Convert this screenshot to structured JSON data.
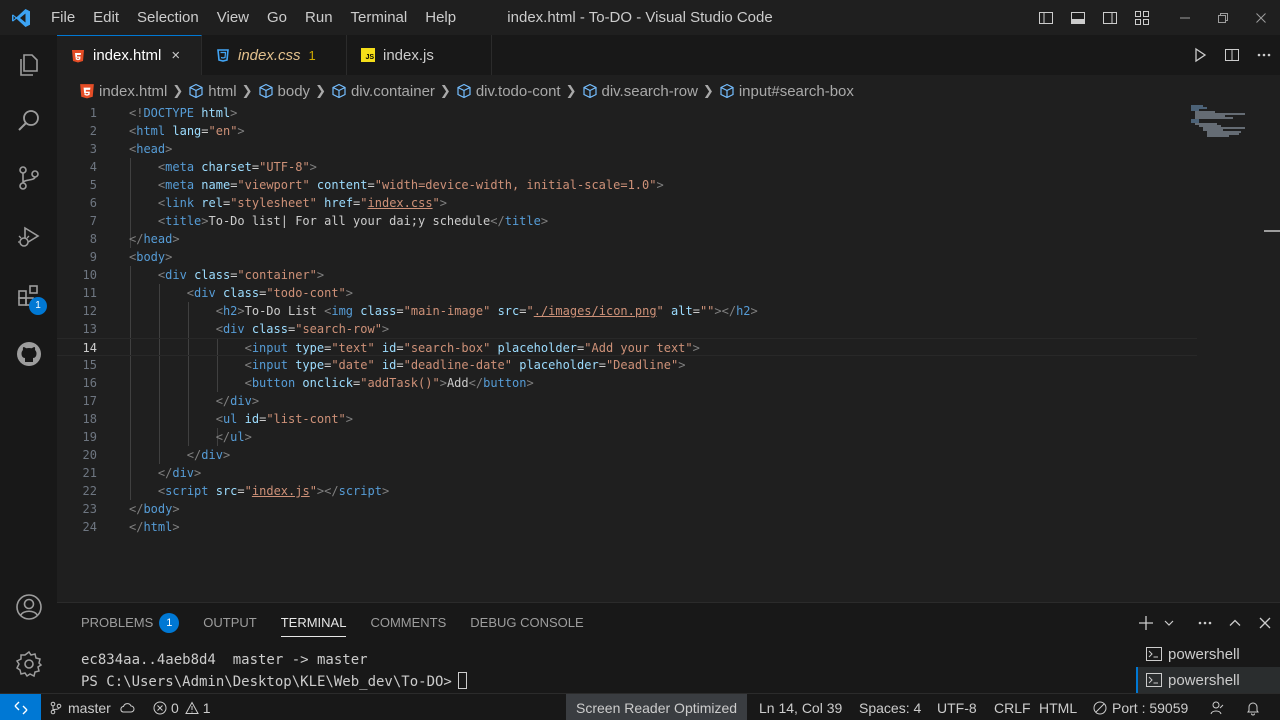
{
  "app": {
    "window_title": "index.html - To-DO - Visual Studio Code",
    "accent": "#0078d4"
  },
  "menu": [
    "File",
    "Edit",
    "Selection",
    "View",
    "Go",
    "Run",
    "Terminal",
    "Help"
  ],
  "activity": {
    "extensions_badge": "1"
  },
  "tabs": [
    {
      "label": "index.html",
      "icon": "html5-icon",
      "active": true,
      "close": "×"
    },
    {
      "label": "index.css",
      "icon": "css-icon",
      "modified": "1"
    },
    {
      "label": "index.js",
      "icon": "js-icon",
      "icon_text": "JS"
    }
  ],
  "breadcrumb": [
    "index.html",
    "html",
    "body",
    "div.container",
    "div.todo-cont",
    "div.search-row",
    "input#search-box"
  ],
  "editor": {
    "current_line": 14,
    "lines": [
      {
        "n": "1",
        "tokens": [
          [
            "punc",
            "<!"
          ],
          [
            "tag",
            "DOCTYPE"
          ],
          [
            "text",
            " "
          ],
          [
            "attr",
            "html"
          ],
          [
            "punc",
            ">"
          ]
        ]
      },
      {
        "n": "2",
        "tokens": [
          [
            "punc",
            "<"
          ],
          [
            "tag",
            "html"
          ],
          [
            "text",
            " "
          ],
          [
            "attr",
            "lang"
          ],
          [
            "text",
            "="
          ],
          [
            "str",
            "\"en\""
          ],
          [
            "punc",
            ">"
          ]
        ]
      },
      {
        "n": "3",
        "tokens": [
          [
            "punc",
            "<"
          ],
          [
            "tag",
            "head"
          ],
          [
            "punc",
            ">"
          ]
        ]
      },
      {
        "n": "4",
        "tokens": [
          [
            "text",
            "    "
          ],
          [
            "punc",
            "<"
          ],
          [
            "tag",
            "meta"
          ],
          [
            "text",
            " "
          ],
          [
            "attr",
            "charset"
          ],
          [
            "text",
            "="
          ],
          [
            "str",
            "\"UTF-8\""
          ],
          [
            "punc",
            ">"
          ]
        ]
      },
      {
        "n": "5",
        "tokens": [
          [
            "text",
            "    "
          ],
          [
            "punc",
            "<"
          ],
          [
            "tag",
            "meta"
          ],
          [
            "text",
            " "
          ],
          [
            "attr",
            "name"
          ],
          [
            "text",
            "="
          ],
          [
            "str",
            "\"viewport\""
          ],
          [
            "text",
            " "
          ],
          [
            "attr",
            "content"
          ],
          [
            "text",
            "="
          ],
          [
            "str",
            "\"width=device-width, initial-scale=1.0\""
          ],
          [
            "punc",
            ">"
          ]
        ]
      },
      {
        "n": "6",
        "tokens": [
          [
            "text",
            "    "
          ],
          [
            "punc",
            "<"
          ],
          [
            "tag",
            "link"
          ],
          [
            "text",
            " "
          ],
          [
            "attr",
            "rel"
          ],
          [
            "text",
            "="
          ],
          [
            "str",
            "\"stylesheet\""
          ],
          [
            "text",
            " "
          ],
          [
            "attr",
            "href"
          ],
          [
            "text",
            "="
          ],
          [
            "str",
            "\""
          ],
          [
            "link",
            "index.css"
          ],
          [
            "str",
            "\""
          ],
          [
            "punc",
            ">"
          ]
        ]
      },
      {
        "n": "7",
        "tokens": [
          [
            "text",
            "    "
          ],
          [
            "punc",
            "<"
          ],
          [
            "tag",
            "title"
          ],
          [
            "punc",
            ">"
          ],
          [
            "text",
            "To-Do list| For all your dai;y schedule"
          ],
          [
            "punc",
            "</"
          ],
          [
            "tag",
            "title"
          ],
          [
            "punc",
            ">"
          ]
        ]
      },
      {
        "n": "8",
        "tokens": [
          [
            "punc",
            "</"
          ],
          [
            "tag",
            "head"
          ],
          [
            "punc",
            ">"
          ]
        ]
      },
      {
        "n": "9",
        "tokens": [
          [
            "punc",
            "<"
          ],
          [
            "tag",
            "body"
          ],
          [
            "punc",
            ">"
          ]
        ]
      },
      {
        "n": "10",
        "tokens": [
          [
            "text",
            "    "
          ],
          [
            "punc",
            "<"
          ],
          [
            "tag",
            "div"
          ],
          [
            "text",
            " "
          ],
          [
            "attr",
            "class"
          ],
          [
            "text",
            "="
          ],
          [
            "str",
            "\"container\""
          ],
          [
            "punc",
            ">"
          ]
        ]
      },
      {
        "n": "11",
        "tokens": [
          [
            "text",
            "        "
          ],
          [
            "punc",
            "<"
          ],
          [
            "tag",
            "div"
          ],
          [
            "text",
            " "
          ],
          [
            "attr",
            "class"
          ],
          [
            "text",
            "="
          ],
          [
            "str",
            "\"todo-cont\""
          ],
          [
            "punc",
            ">"
          ]
        ]
      },
      {
        "n": "12",
        "tokens": [
          [
            "text",
            "            "
          ],
          [
            "punc",
            "<"
          ],
          [
            "tag",
            "h2"
          ],
          [
            "punc",
            ">"
          ],
          [
            "text",
            "To-Do List "
          ],
          [
            "punc",
            "<"
          ],
          [
            "tag",
            "img"
          ],
          [
            "text",
            " "
          ],
          [
            "attr",
            "class"
          ],
          [
            "text",
            "="
          ],
          [
            "str",
            "\"main-image\""
          ],
          [
            "text",
            " "
          ],
          [
            "attr",
            "src"
          ],
          [
            "text",
            "="
          ],
          [
            "str",
            "\""
          ],
          [
            "link",
            "./images/icon.png"
          ],
          [
            "str",
            "\""
          ],
          [
            "text",
            " "
          ],
          [
            "attr",
            "alt"
          ],
          [
            "text",
            "="
          ],
          [
            "str",
            "\"\""
          ],
          [
            "punc",
            "></"
          ],
          [
            "tag",
            "h2"
          ],
          [
            "punc",
            ">"
          ]
        ]
      },
      {
        "n": "13",
        "tokens": [
          [
            "text",
            "            "
          ],
          [
            "punc",
            "<"
          ],
          [
            "tag",
            "div"
          ],
          [
            "text",
            " "
          ],
          [
            "attr",
            "class"
          ],
          [
            "text",
            "="
          ],
          [
            "str",
            "\"search-row\""
          ],
          [
            "punc",
            ">"
          ]
        ]
      },
      {
        "n": "14",
        "tokens": [
          [
            "text",
            "                "
          ],
          [
            "punc",
            "<"
          ],
          [
            "tag",
            "input"
          ],
          [
            "text",
            " "
          ],
          [
            "attr",
            "type"
          ],
          [
            "text",
            "="
          ],
          [
            "str",
            "\"text\""
          ],
          [
            "text",
            " "
          ],
          [
            "attr",
            "id"
          ],
          [
            "text",
            "="
          ],
          [
            "str",
            "\"search-box\""
          ],
          [
            "text",
            " "
          ],
          [
            "attr",
            "placeholder"
          ],
          [
            "text",
            "="
          ],
          [
            "str",
            "\"Add your text\""
          ],
          [
            "punc",
            ">"
          ]
        ]
      },
      {
        "n": "15",
        "tokens": [
          [
            "text",
            "                "
          ],
          [
            "punc",
            "<"
          ],
          [
            "tag",
            "input"
          ],
          [
            "text",
            " "
          ],
          [
            "attr",
            "type"
          ],
          [
            "text",
            "="
          ],
          [
            "str",
            "\"date\""
          ],
          [
            "text",
            " "
          ],
          [
            "attr",
            "id"
          ],
          [
            "text",
            "="
          ],
          [
            "str",
            "\"deadline-date\""
          ],
          [
            "text",
            " "
          ],
          [
            "attr",
            "placeholder"
          ],
          [
            "text",
            "="
          ],
          [
            "str",
            "\"Deadline\""
          ],
          [
            "punc",
            ">"
          ]
        ]
      },
      {
        "n": "16",
        "tokens": [
          [
            "text",
            "                "
          ],
          [
            "punc",
            "<"
          ],
          [
            "tag",
            "button"
          ],
          [
            "text",
            " "
          ],
          [
            "attr",
            "onclick"
          ],
          [
            "text",
            "="
          ],
          [
            "str",
            "\"addTask()\""
          ],
          [
            "punc",
            ">"
          ],
          [
            "text",
            "Add"
          ],
          [
            "punc",
            "</"
          ],
          [
            "tag",
            "button"
          ],
          [
            "punc",
            ">"
          ]
        ]
      },
      {
        "n": "17",
        "tokens": [
          [
            "text",
            "            "
          ],
          [
            "punc",
            "</"
          ],
          [
            "tag",
            "div"
          ],
          [
            "punc",
            ">"
          ]
        ]
      },
      {
        "n": "18",
        "tokens": [
          [
            "text",
            "            "
          ],
          [
            "punc",
            "<"
          ],
          [
            "tag",
            "ul"
          ],
          [
            "text",
            " "
          ],
          [
            "attr",
            "id"
          ],
          [
            "text",
            "="
          ],
          [
            "str",
            "\"list-cont\""
          ],
          [
            "punc",
            ">"
          ]
        ]
      },
      {
        "n": "19",
        "tokens": [
          [
            "text",
            "            "
          ],
          [
            "punc",
            "</"
          ],
          [
            "tag",
            "ul"
          ],
          [
            "punc",
            ">"
          ]
        ]
      },
      {
        "n": "20",
        "tokens": [
          [
            "text",
            "        "
          ],
          [
            "punc",
            "</"
          ],
          [
            "tag",
            "div"
          ],
          [
            "punc",
            ">"
          ]
        ]
      },
      {
        "n": "21",
        "tokens": [
          [
            "text",
            "    "
          ],
          [
            "punc",
            "</"
          ],
          [
            "tag",
            "div"
          ],
          [
            "punc",
            ">"
          ]
        ]
      },
      {
        "n": "22",
        "tokens": [
          [
            "text",
            "    "
          ],
          [
            "punc",
            "<"
          ],
          [
            "tag",
            "script"
          ],
          [
            "text",
            " "
          ],
          [
            "attr",
            "src"
          ],
          [
            "text",
            "="
          ],
          [
            "str",
            "\""
          ],
          [
            "link",
            "index.js"
          ],
          [
            "str",
            "\""
          ],
          [
            "punc",
            "></"
          ],
          [
            "tag",
            "script"
          ],
          [
            "punc",
            ">"
          ]
        ]
      },
      {
        "n": "23",
        "tokens": [
          [
            "punc",
            "</"
          ],
          [
            "tag",
            "body"
          ],
          [
            "punc",
            ">"
          ]
        ]
      },
      {
        "n": "24",
        "tokens": [
          [
            "punc",
            "</"
          ],
          [
            "tag",
            "html"
          ],
          [
            "punc",
            ">"
          ]
        ]
      }
    ]
  },
  "panel": {
    "tabs": [
      "PROBLEMS",
      "OUTPUT",
      "TERMINAL",
      "COMMENTS",
      "DEBUG CONSOLE"
    ],
    "problems_badge": "1",
    "active_tab": "TERMINAL",
    "terminal_lines": [
      "ec834aa..4aeb8d4  master -> master",
      "PS C:\\Users\\Admin\\Desktop\\KLE\\Web_dev\\To-DO>"
    ],
    "terminals": [
      "powershell",
      "powershell"
    ]
  },
  "status": {
    "branch": "master",
    "errors": "0",
    "warnings": "1",
    "screen_reader": "Screen Reader Optimized",
    "position": "Ln 14, Col 39",
    "spaces": "Spaces: 4",
    "encoding": "UTF-8",
    "eol": "CRLF",
    "language": "HTML",
    "port": "Port : 59059"
  }
}
